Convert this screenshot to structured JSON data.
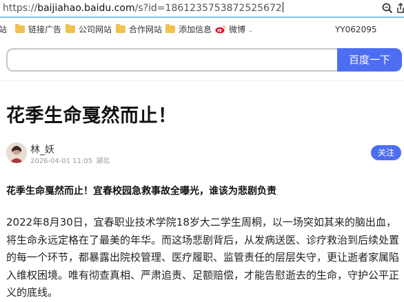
{
  "browser": {
    "url_prefix": "https://",
    "url_host": "baijiahao.baidu.com",
    "url_rest": "/s?id=1861235753872525672",
    "zoom_icon": "zoom-icon",
    "share_icon": "share-icon"
  },
  "bookmarks": {
    "items": [
      {
        "label": "站",
        "icon": "folder-icon"
      },
      {
        "label": "链接广告",
        "icon": "folder-icon"
      },
      {
        "label": "公司网站",
        "icon": "folder-icon"
      },
      {
        "label": "合作网站",
        "icon": "folder-icon"
      },
      {
        "label": "添加信息",
        "icon": "folder-icon"
      },
      {
        "label": "微博",
        "icon": "weibo-icon"
      }
    ],
    "right_text": "YY062095",
    "colors": {
      "folder": "#f2c14e"
    }
  },
  "search": {
    "placeholder": "",
    "button_label": "百度一下",
    "accent": "#4e6ef2"
  },
  "article": {
    "title": "花季生命戛然而止！",
    "author": "林_妖",
    "date": "2026-04-01 11:05",
    "location": "湖北",
    "follow_label": "关注",
    "subheading": "花季生命戛然而止！宜春校园急救事故全曝光，谁该为悲剧负责",
    "paragraph": "2022年8月30日，宜春职业技术学院18岁大二学生周桐，以一场突如其来的脑出血，将生命永远定格在了最美的年华。而这场悲剧背后，从发病送医、诊疗救治到后续处置的每一个环节，都暴露出院校管理、医疗履职、监管责任的层层失守，更让逝者家属陷入维权困境。唯有彻查真相、严肃追责、足额赔偿，才能告慰逝去的生命，守护公平正义的底线。"
  }
}
